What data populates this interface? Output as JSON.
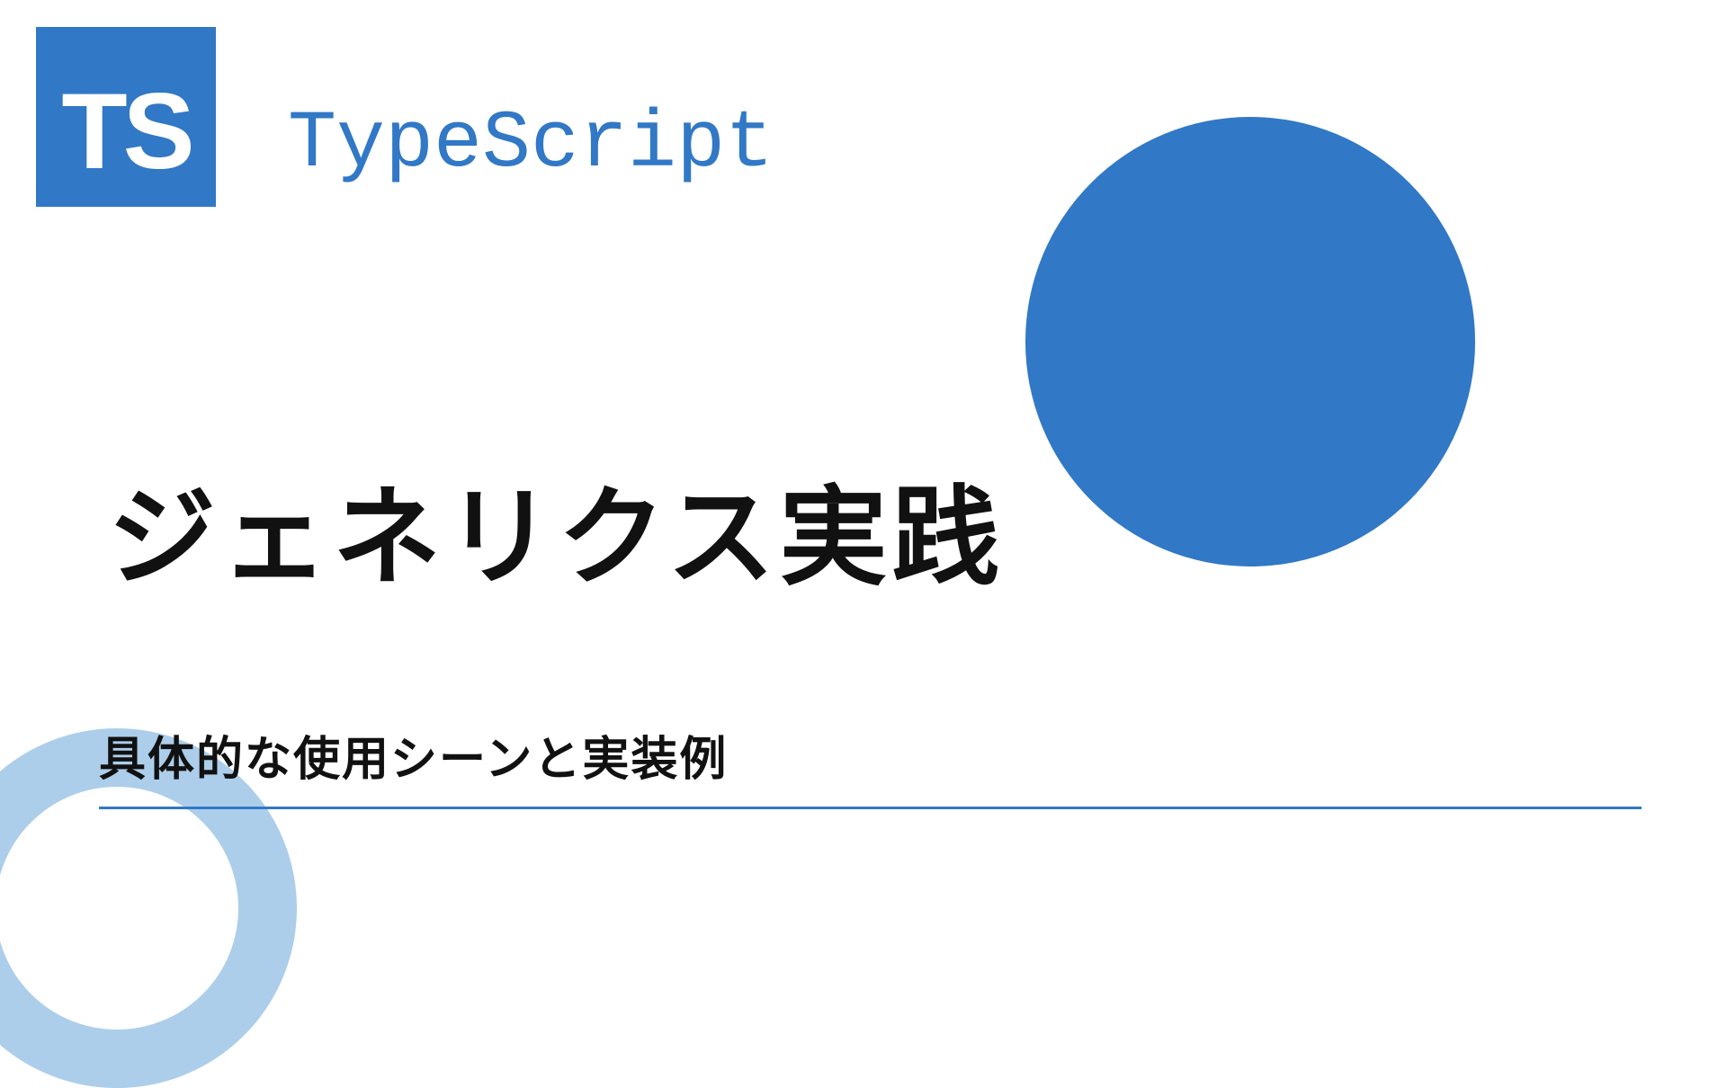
{
  "logo": {
    "badge_text": "TS",
    "brand_name": "TypeScript"
  },
  "title": "ジェネリクス実践",
  "subtitle": "具体的な使用シーンと実装例",
  "colors": {
    "primary": "#3178c6",
    "ring": "#9ec5e8",
    "text": "#111111"
  }
}
